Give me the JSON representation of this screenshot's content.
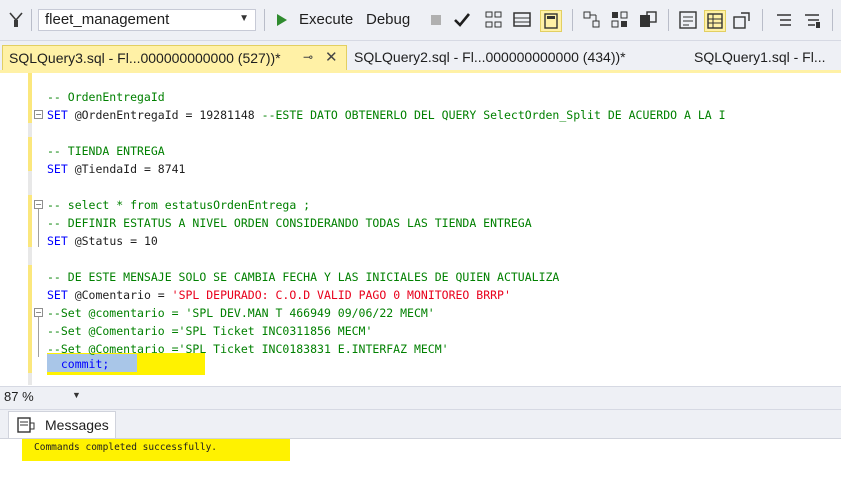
{
  "toolbar": {
    "database": "fleet_management",
    "execute_label": "Execute",
    "debug_label": "Debug"
  },
  "tabs": [
    {
      "label": "SQLQuery3.sql - Fl...000000000000 (527))*",
      "active": true
    },
    {
      "label": "SQLQuery2.sql - Fl...000000000000 (434))*",
      "active": false
    },
    {
      "label": "SQLQuery1.sql - Fl...",
      "active": false
    }
  ],
  "editor": {
    "lines": [
      {
        "parts": [
          {
            "t": "-- OrdenEntregaId",
            "c": "cm"
          }
        ]
      },
      {
        "parts": [
          {
            "t": "SET ",
            "c": "kw"
          },
          {
            "t": "@OrdenEntregaId = 19281148 ",
            "c": ""
          },
          {
            "t": "--ESTE DATO OBTENERLO DEL QUERY SelectOrden_Split DE ACUERDO A LA I",
            "c": "cm"
          }
        ]
      },
      {
        "parts": [
          {
            "t": "",
            "c": ""
          }
        ]
      },
      {
        "parts": [
          {
            "t": "-- TIENDA ENTREGA",
            "c": "cm"
          }
        ]
      },
      {
        "parts": [
          {
            "t": "SET ",
            "c": "kw"
          },
          {
            "t": "@TiendaId = 8741",
            "c": ""
          }
        ]
      },
      {
        "parts": [
          {
            "t": "",
            "c": ""
          }
        ]
      },
      {
        "parts": [
          {
            "t": "-- select * from estatusOrdenEntrega ;",
            "c": "cm"
          }
        ]
      },
      {
        "parts": [
          {
            "t": "-- DEFINIR ESTATUS A NIVEL ORDEN CONSIDERANDO TODAS LAS TIENDA ENTREGA",
            "c": "cm"
          }
        ]
      },
      {
        "parts": [
          {
            "t": "SET ",
            "c": "kw"
          },
          {
            "t": "@Status = 10",
            "c": ""
          }
        ]
      },
      {
        "parts": [
          {
            "t": "",
            "c": ""
          }
        ]
      },
      {
        "parts": [
          {
            "t": "-- DE ESTE MENSAJE SOLO SE CAMBIA FECHA Y LAS INICIALES DE QUIEN ACTUALIZA",
            "c": "cm"
          }
        ]
      },
      {
        "parts": [
          {
            "t": "SET ",
            "c": "kw"
          },
          {
            "t": "@Comentario = ",
            "c": ""
          },
          {
            "t": "'SPL DEPURADO: C.O.D VALID PAGO 0 MONITOREO BRRP'",
            "c": "st"
          }
        ]
      },
      {
        "parts": [
          {
            "t": "--Set @comentario = 'SPL DEV.MAN T 466949 09/06/22 MECM'",
            "c": "cm"
          }
        ]
      },
      {
        "parts": [
          {
            "t": "--Set @Comentario ='SPL Ticket INC0311856 MECM'",
            "c": "cm"
          }
        ]
      },
      {
        "parts": [
          {
            "t": "--Set @Comentario ='SPL Ticket INC0183831 E.INTERFAZ MECM'",
            "c": "cm"
          }
        ]
      },
      {
        "parts": [
          {
            "t": "  commit;",
            "c": "kw"
          }
        ]
      }
    ]
  },
  "zoom": "87 %",
  "results": {
    "tab_label": "Messages",
    "message": "Commands completed successfully."
  },
  "colors": {
    "keyword": "#0000ff",
    "comment": "#008000",
    "string": "#e8001c",
    "highlight": "#fff200",
    "active_tab": "#fff1a6"
  }
}
